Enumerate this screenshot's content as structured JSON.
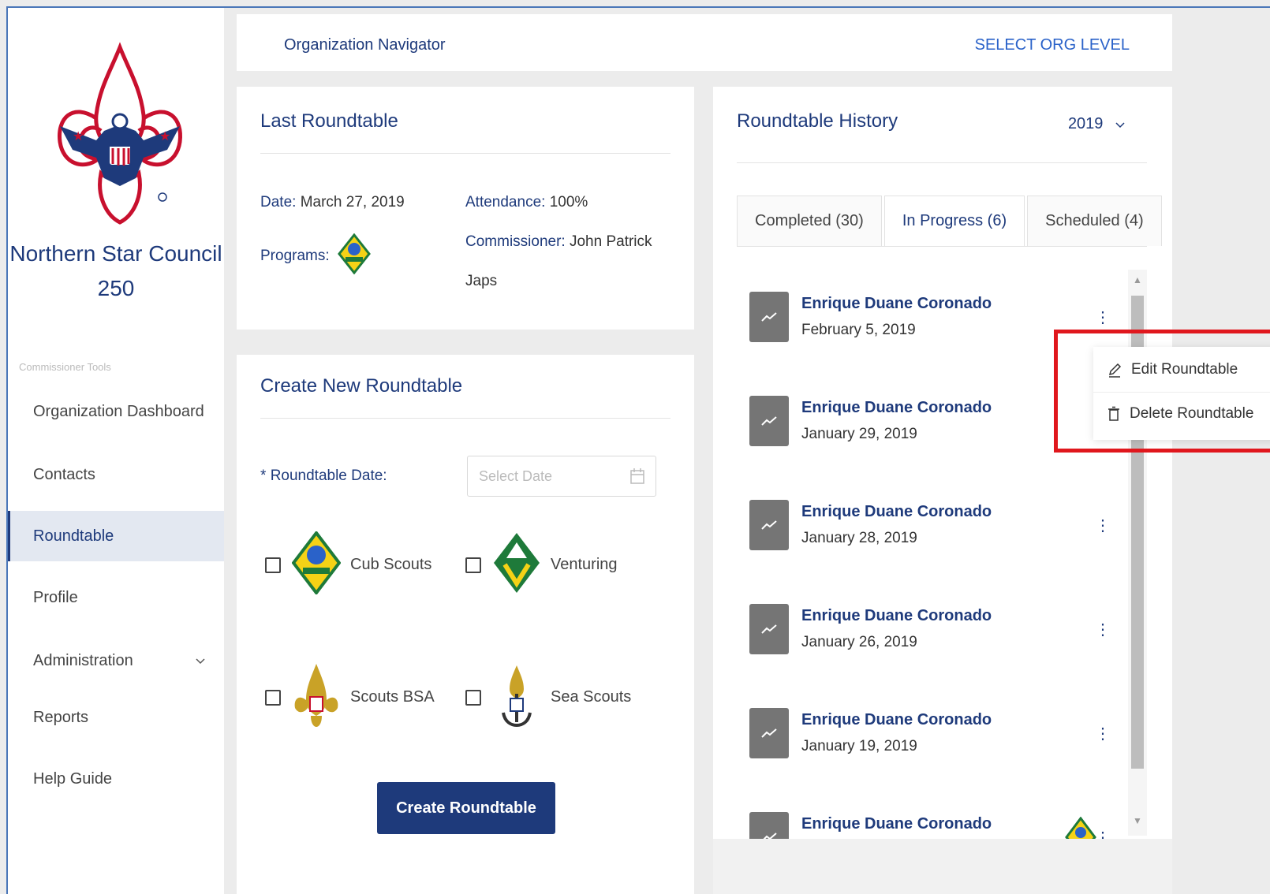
{
  "sidebar": {
    "council_name_line1": "Northern Star Council",
    "council_name_line2": "250",
    "section_label": "Commissioner Tools",
    "items": [
      {
        "label": "Organization Dashboard"
      },
      {
        "label": "Contacts"
      },
      {
        "label": "Roundtable"
      },
      {
        "label": "Profile"
      },
      {
        "label": "Administration",
        "chevron": "chevron-down-icon"
      },
      {
        "label": "Reports"
      },
      {
        "label": "Help Guide"
      }
    ],
    "active_item": "Roundtable"
  },
  "header": {
    "title": "Organization Navigator",
    "select_org_label": "SELECT ORG LEVEL"
  },
  "last_roundtable": {
    "title": "Last Roundtable",
    "date_label": "Date:",
    "date_value": "March 27, 2019",
    "attendance_label": "Attendance:",
    "attendance_value": "100%",
    "programs_label": "Programs:",
    "commissioner_label": "Commissioner:",
    "commissioner_value_line1": "John Patrick",
    "commissioner_value_line2": "Japs"
  },
  "create_roundtable": {
    "title": "Create New Roundtable",
    "required_marker": "*",
    "date_label": "Roundtable Date",
    "date_colon": ":",
    "date_placeholder": "Select Date",
    "programs": [
      {
        "label": "Cub Scouts",
        "icon": "cub-scouts-icon"
      },
      {
        "label": "Venturing",
        "icon": "venturing-icon"
      },
      {
        "label": "Scouts BSA",
        "icon": "scouts-bsa-icon"
      },
      {
        "label": "Sea Scouts",
        "icon": "sea-scouts-icon"
      }
    ],
    "submit_label": "Create Roundtable"
  },
  "history": {
    "title": "Roundtable History",
    "year": "2019",
    "tabs": [
      {
        "label": "Completed (30)"
      },
      {
        "label": "In Progress (6)"
      },
      {
        "label": "Scheduled (4)"
      }
    ],
    "active_tab": "In Progress (6)",
    "items": [
      {
        "name": "Enrique Duane Coronado",
        "date": "February 5, 2019"
      },
      {
        "name": "Enrique Duane Coronado",
        "date": "January 29, 2019"
      },
      {
        "name": "Enrique Duane Coronado",
        "date": "January 28, 2019"
      },
      {
        "name": "Enrique Duane Coronado",
        "date": "January 26, 2019"
      },
      {
        "name": "Enrique Duane Coronado",
        "date": "January 19, 2019"
      },
      {
        "name": "Enrique Duane Coronado",
        "date": ""
      }
    ],
    "context_menu": {
      "edit_label": "Edit Roundtable",
      "delete_label": "Delete Roundtable"
    }
  },
  "colors": {
    "brand_navy": "#1e3a7b",
    "link_blue": "#2a62c9",
    "highlight_red": "#e0171d"
  }
}
